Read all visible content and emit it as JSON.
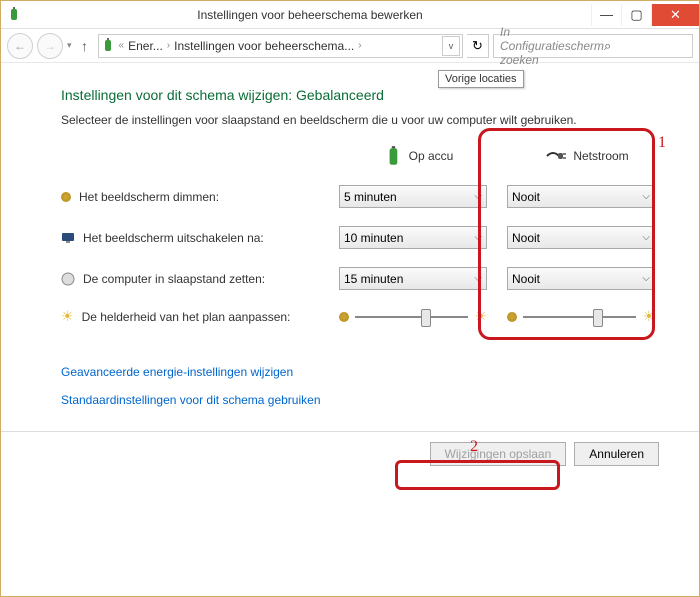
{
  "window": {
    "title": "Instellingen voor beheerschema bewerken"
  },
  "breadcrumb": {
    "seg1": "Ener...",
    "seg2": "Instellingen voor beheerschema..."
  },
  "search": {
    "placeholder": "In Configuratiescherm zoeken"
  },
  "tooltip": "Vorige locaties",
  "page": {
    "title": "Instellingen voor dit schema wijzigen: Gebalanceerd",
    "subtitle": "Selecteer de instellingen voor slaapstand en beeldscherm die u voor uw computer wilt gebruiken."
  },
  "columns": {
    "battery": "Op accu",
    "plugged": "Netstroom"
  },
  "rows": {
    "dim": {
      "label": "Het beeldscherm dimmen:",
      "battery": "5 minuten",
      "plugged": "Nooit"
    },
    "off": {
      "label": "Het beeldscherm uitschakelen na:",
      "battery": "10 minuten",
      "plugged": "Nooit"
    },
    "sleep": {
      "label": "De computer in slaapstand zetten:",
      "battery": "15 minuten",
      "plugged": "Nooit"
    },
    "bright": {
      "label": "De helderheid van het plan aanpassen:"
    }
  },
  "links": {
    "advanced": "Geavanceerde energie-instellingen wijzigen",
    "defaults": "Standaardinstellingen voor dit schema gebruiken"
  },
  "buttons": {
    "save": "Wijzigingen opslaan",
    "cancel": "Annuleren"
  },
  "annotations": {
    "one": "1",
    "two": "2"
  }
}
